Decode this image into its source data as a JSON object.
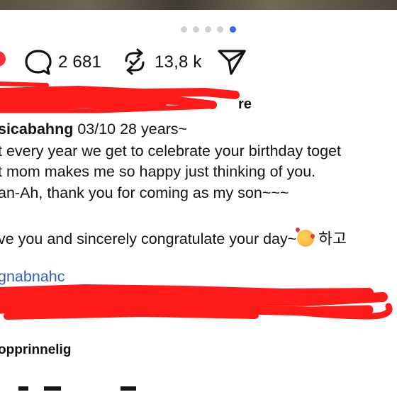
{
  "carousel": {
    "total": 5,
    "active_index": 4
  },
  "actions": {
    "comments_count": "2 681",
    "reposts_count": "13,8 k"
  },
  "caption": {
    "partial_label": "re",
    "username": "sicabahng",
    "header_rest": " 03/10 28 years~",
    "lines": [
      "t every year we get to celebrate your birthday toget",
      "t mom makes me so happy just thinking of you.",
      "an-Ah, thank you for coming as my son~~~",
      "ve you and sincerely congratulate your day~"
    ],
    "trailing_text": " 하고",
    "link": "gnabnahc"
  },
  "comments": {
    "next_username": "opprinnelig"
  },
  "colors": {
    "accent_blue": "#3f63e8",
    "link_blue": "#2f5fbf",
    "redaction_red": "#ff1a1a",
    "like_red": "#ff2e3b"
  }
}
